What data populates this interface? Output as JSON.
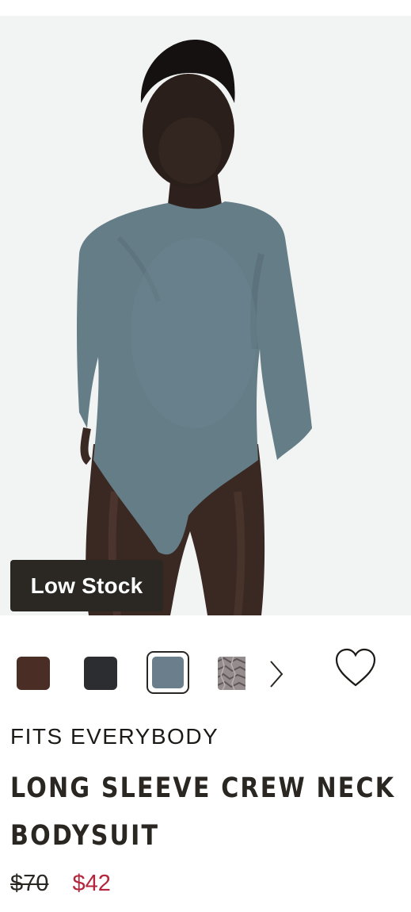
{
  "product": {
    "badge": "Low Stock",
    "brand": "FITS EVERYBODY",
    "title": "LONG SLEEVE CREW NECK BODYSUIT",
    "price_original": "$70",
    "price_sale": "$42"
  },
  "swatches": [
    {
      "name": "brown",
      "color": "#4a2e26",
      "selected": false
    },
    {
      "name": "black",
      "color": "#2c2d30",
      "selected": false
    },
    {
      "name": "slate-blue",
      "color": "#6a7e8b",
      "selected": true
    },
    {
      "name": "snake-print",
      "color": "#8d8788",
      "selected": false
    }
  ],
  "icons": {
    "next": "chevron-right-icon",
    "wishlist": "heart-outline-icon"
  },
  "colors": {
    "sale": "#b3263e",
    "badge_bg": "#2b2824",
    "text": "#2a2622"
  }
}
